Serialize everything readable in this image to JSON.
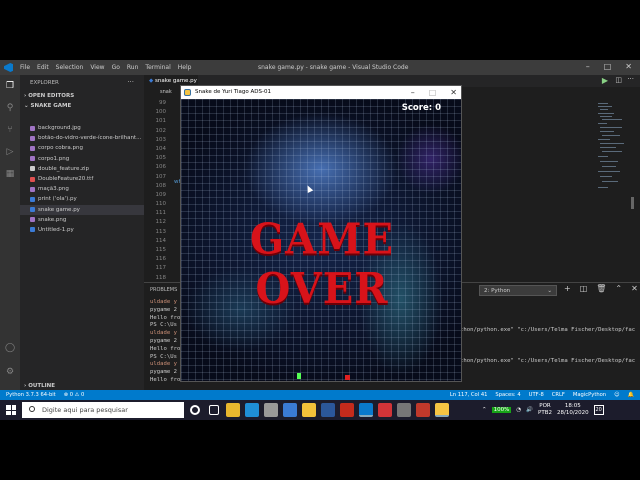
{
  "vscode": {
    "menu": [
      "File",
      "Edit",
      "Selection",
      "View",
      "Go",
      "Run",
      "Terminal",
      "Help"
    ],
    "window_title": "snake game.py - snake game - Visual Studio Code",
    "sidebar": {
      "header": "EXPLORER",
      "open_editors": "OPEN EDITORS",
      "folder": "SNAKE GAME",
      "outline": "OUTLINE",
      "files": [
        {
          "name": "background.jpg",
          "color": "#a074c4"
        },
        {
          "name": "botão-do-vidro-verde-ícone-brilhant...",
          "color": "#a074c4"
        },
        {
          "name": "corpo cobra.png",
          "color": "#a074c4"
        },
        {
          "name": "corpo1.png",
          "color": "#a074c4"
        },
        {
          "name": "double_feature.zip",
          "color": "#cccccc"
        },
        {
          "name": "DoubleFeature20.ttf",
          "color": "#e05050"
        },
        {
          "name": "maçã3.png",
          "color": "#a074c4"
        },
        {
          "name": "print ('ola').py",
          "color": "#3b7bd6"
        },
        {
          "name": "snake game.py",
          "color": "#3b7bd6",
          "selected": true
        },
        {
          "name": "snake.png",
          "color": "#a074c4"
        },
        {
          "name": "Untitled-1.py",
          "color": "#3b7bd6"
        }
      ]
    },
    "editor": {
      "tab": "snake game.py",
      "breadcrumb": "snak",
      "line_numbers": [
        "99",
        "100",
        "101",
        "102",
        "103",
        "104",
        "105",
        "106",
        "107",
        "108",
        "109",
        "110",
        "111",
        "112",
        "113",
        "114",
        "115",
        "116",
        "117",
        "118"
      ],
      "visible_code": "wh"
    },
    "panel": {
      "header": "PROBLEMS",
      "terminal_select": "2: Python",
      "terminal_lines": [
        {
          "text": "uldade y",
          "hl": true
        },
        {
          "text": "pygame 2",
          "hl": false
        },
        {
          "text": "Hello fro",
          "hl": false
        },
        {
          "text": "PS C:\\Us",
          "hl": false
        },
        {
          "text": "uldade y",
          "hl": true
        },
        {
          "text": "pygame 2",
          "hl": false
        },
        {
          "text": "Hello fro",
          "hl": false
        },
        {
          "text": "PS C:\\Us",
          "hl": false
        },
        {
          "text": "uldade y",
          "hl": true
        },
        {
          "text": "pygame 2",
          "hl": false
        },
        {
          "text": "Hello fro",
          "hl": false
        }
      ],
      "terminal_right_1": "thon/python.exe\" \"c:/Users/Telma Fischer/Desktop/fac",
      "terminal_right_2": "thon/python.exe\" \"c:/Users/Telma Fischer/Desktop/fac"
    },
    "status": {
      "python": "Python 3.7.3 64-bit",
      "errors": "⊗ 0  ⚠ 0",
      "position": "Ln 117, Col 41",
      "spaces": "Spaces: 4",
      "encoding": "UTF-8",
      "eol": "CRLF",
      "language": "MagicPython"
    }
  },
  "game": {
    "title": "Snake de Yuri Tiago ADS-01",
    "score": "Score: 0",
    "message": "GAME OVER",
    "colors": {
      "message": "#d8131a",
      "snake": "#55ff55",
      "food": "#e02020"
    }
  },
  "taskbar": {
    "search_placeholder": "Digite aqui para pesquisar",
    "battery": "100%",
    "lang": "POR",
    "layout": "PTB2",
    "time": "18:05",
    "date": "28/10/2020",
    "notifications": "20",
    "app_icons": [
      {
        "name": "chrome-icon",
        "color": "#e8b72e"
      },
      {
        "name": "edge-icon",
        "color": "#1f8fd6"
      },
      {
        "name": "store-icon",
        "color": "#999999"
      },
      {
        "name": "mail-icon",
        "color": "#3a7bd5"
      },
      {
        "name": "explorer-icon",
        "color": "#f3c13a"
      },
      {
        "name": "word-icon",
        "color": "#2b579a"
      },
      {
        "name": "app-red-icon",
        "color": "#c42b1c"
      },
      {
        "name": "vscode-icon",
        "color": "#0a7acc"
      },
      {
        "name": "app-red2-icon",
        "color": "#d13438"
      },
      {
        "name": "clock-icon",
        "color": "#777777"
      },
      {
        "name": "photos-icon",
        "color": "#c0392b"
      },
      {
        "name": "python-icon",
        "color": "#f5c443"
      }
    ]
  }
}
